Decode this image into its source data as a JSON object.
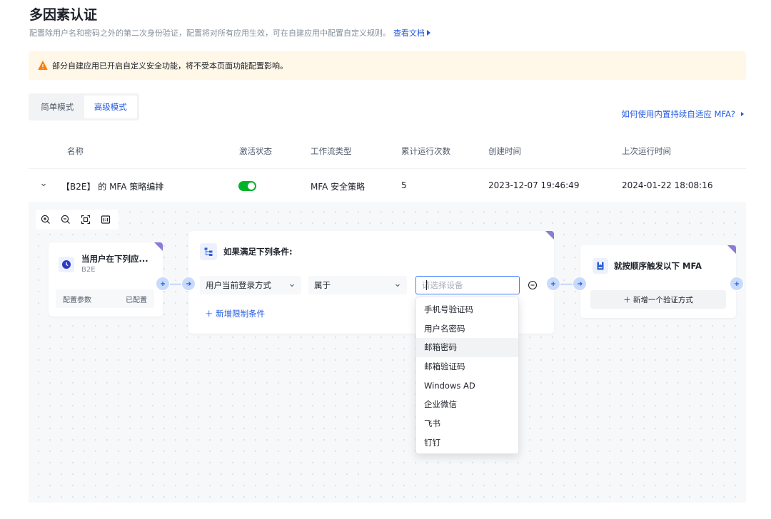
{
  "header": {
    "title": "多因素认证",
    "description": "配置除用户名和密码之外的第二次身份验证，配置将对所有应用生效，可在自建应用中配置自定义规则。",
    "doc_link": "查看文档"
  },
  "alert": {
    "text": "部分自建应用已开启自定义安全功能，将不受本页面功能配置影响。",
    "color": "#ff7d00"
  },
  "mode_tabs": [
    {
      "label": "简单模式",
      "active": false
    },
    {
      "label": "高级模式",
      "active": true
    }
  ],
  "help_link": "如何使用内置持续自适应 MFA?",
  "table": {
    "columns": [
      "名称",
      "激活状态",
      "工作流类型",
      "累计运行次数",
      "创建时间",
      "上次运行时间"
    ],
    "row": {
      "name": "【B2E】 的 MFA 策略编排",
      "active": true,
      "workflow_type": "MFA 安全策略",
      "run_count": "5",
      "created_at": "2023-12-07 19:46:49",
      "last_run_at": "2024-01-22 18:08:16"
    }
  },
  "toolbar": {
    "icons": [
      "zoom-in-icon",
      "zoom-out-icon",
      "fit-view-icon",
      "actual-size-icon"
    ]
  },
  "flow": {
    "trigger_node": {
      "title": "当用户在下列应...",
      "subtitle": "B2E",
      "config_label": "配置参数",
      "config_status": "已配置"
    },
    "condition_node": {
      "title": "如果满足下列条件:",
      "field": "用户当前登录方式",
      "operator": "属于",
      "value_placeholder": "请选择设备",
      "add_condition": "新增限制条件"
    },
    "mfa_node": {
      "title": "就按顺序触发以下 MFA",
      "add_label": "新增一个验证方式"
    },
    "dropdown_options": [
      "手机号验证码",
      "用户名密码",
      "邮箱密码",
      "邮箱验证码",
      "Windows AD",
      "企业微信",
      "飞书",
      "钉钉"
    ],
    "hovered_option": "邮箱密码"
  },
  "colors": {
    "accent": "#215ae5",
    "toggle_on": "#00b42a",
    "corner": "#8b7ad8"
  }
}
